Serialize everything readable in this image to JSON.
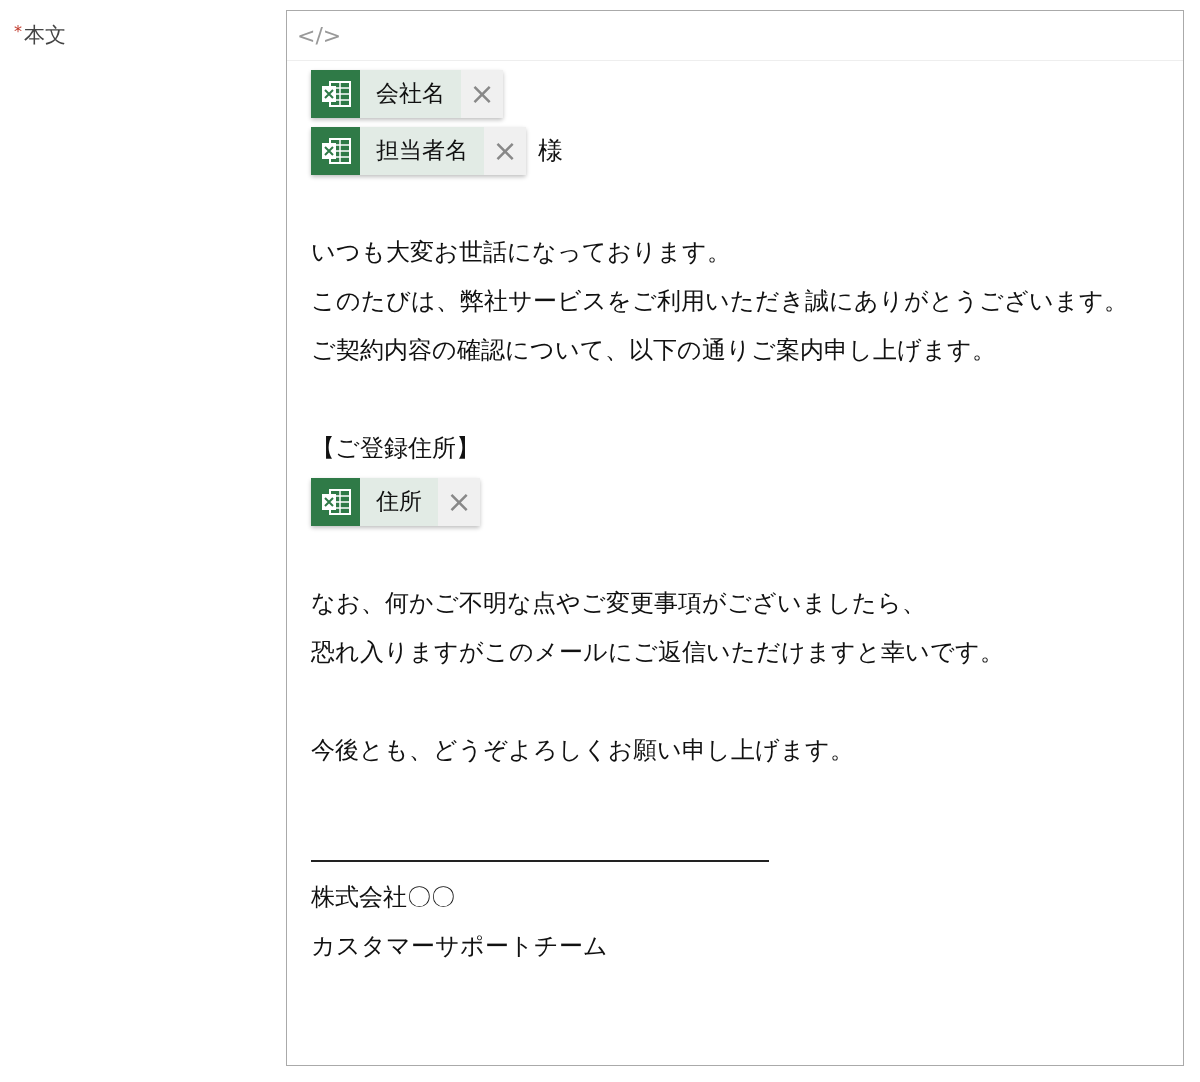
{
  "field_label": {
    "required_mark": "*",
    "text": "本文"
  },
  "editor": {
    "toolbar": {
      "source_button": "</>"
    },
    "lines": [
      {
        "kind": "field",
        "label": "会社名",
        "close": "×"
      },
      {
        "kind": "field",
        "label": "担当者名",
        "close": "×",
        "suffix": "様"
      },
      {
        "kind": "blank"
      },
      {
        "kind": "text",
        "text": "いつも大変お世話になっております。"
      },
      {
        "kind": "text",
        "text": "このたびは、弊社サービスをご利用いただき誠にありがとうございます。"
      },
      {
        "kind": "text",
        "text": "ご契約内容の確認について、以下の通りご案内申し上げます。"
      },
      {
        "kind": "blank"
      },
      {
        "kind": "text",
        "text": "【ご登録住所】"
      },
      {
        "kind": "field",
        "label": "住所",
        "close": "×"
      },
      {
        "kind": "blank"
      },
      {
        "kind": "text",
        "text": "なお、何かご不明な点やご変更事項がございましたら、"
      },
      {
        "kind": "text",
        "text": "恐れ入りますがこのメールにご返信いただけますと幸いです。"
      },
      {
        "kind": "blank"
      },
      {
        "kind": "text",
        "text": "今後とも、どうぞよろしくお願い申し上げます。"
      },
      {
        "kind": "blank"
      },
      {
        "kind": "rule"
      },
      {
        "kind": "text",
        "text": "株式会社〇〇"
      },
      {
        "kind": "text",
        "text": "カスタマーサポートチーム"
      }
    ]
  }
}
